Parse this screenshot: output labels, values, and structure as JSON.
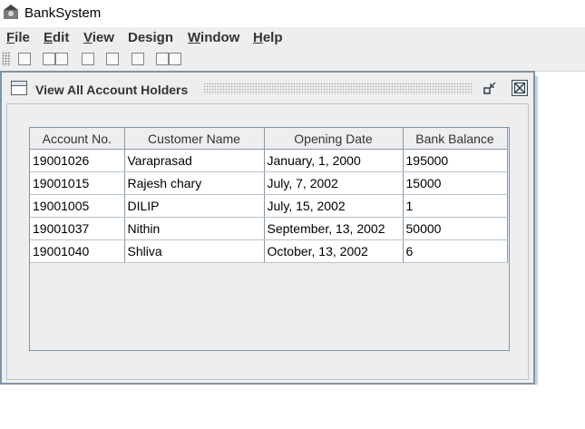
{
  "window": {
    "title": "BankSystem"
  },
  "menu": [
    {
      "label": "File",
      "mnemonic": "F",
      "rest": "ile"
    },
    {
      "label": "Edit",
      "mnemonic": "E",
      "rest": "dit"
    },
    {
      "label": "View",
      "mnemonic": "V",
      "rest": "iew"
    },
    {
      "label": "Design",
      "mnemonic": "",
      "rest": "Design"
    },
    {
      "label": "Window",
      "mnemonic": "W",
      "rest": "indow"
    },
    {
      "label": "Help",
      "mnemonic": "H",
      "rest": "elp"
    }
  ],
  "internal_frame": {
    "title": "View All Account Holders"
  },
  "table": {
    "columns": [
      "Account No.",
      "Customer Name",
      "Opening Date",
      "Bank Balance"
    ],
    "rows": [
      [
        "19001026",
        "Varaprasad",
        "January, 1, 2000",
        "195000"
      ],
      [
        "19001015",
        "Rajesh chary",
        "July, 7, 2002",
        "15000"
      ],
      [
        "19001005",
        "DILIP",
        "July, 15, 2002",
        "1"
      ],
      [
        "19001037",
        "Nithin",
        "September, 13, 2002",
        "50000"
      ],
      [
        "19001040",
        "Shliva",
        "October, 13, 2002",
        "6"
      ]
    ]
  },
  "colors": {
    "frame_border": "#7e94a6",
    "panel_bg": "#eeeeee",
    "grid_line": "#8a9aaa"
  }
}
